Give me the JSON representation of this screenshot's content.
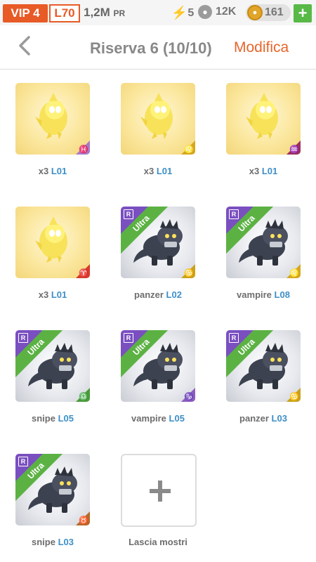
{
  "topbar": {
    "vip": "VIP 4",
    "level": "L70",
    "pr_value": "1,2M",
    "pr_unit": "PR",
    "energy": "5",
    "paw": "12K",
    "coins": "161",
    "add_label": "+"
  },
  "header": {
    "title": "Riserva 6 (10/10)",
    "edit": "Modifica"
  },
  "items": [
    {
      "name": "x3",
      "level": "L01",
      "style": "gold",
      "sign": "♓",
      "sign_color": "#a77ac4"
    },
    {
      "name": "x3",
      "level": "L01",
      "style": "gold",
      "sign": "♌",
      "sign_color": "#d4a81e"
    },
    {
      "name": "x3",
      "level": "L01",
      "style": "gold",
      "sign": "♒",
      "sign_color": "#9c2f5d"
    },
    {
      "name": "x3",
      "level": "L01",
      "style": "gold",
      "sign": "♈",
      "sign_color": "#d63a2a"
    },
    {
      "name": "panzer",
      "level": "L02",
      "style": "ultra",
      "sign": "♋",
      "sign_color": "#c8a21a",
      "badge": "Ultra",
      "rarity": "R"
    },
    {
      "name": "vampire",
      "level": "L08",
      "style": "ultra",
      "sign": "♌",
      "sign_color": "#d4a81e",
      "badge": "Ultra",
      "rarity": "R"
    },
    {
      "name": "snipe",
      "level": "L05",
      "style": "ultra",
      "sign": "♎",
      "sign_color": "#4a9b3a",
      "badge": "Ultra",
      "rarity": "R"
    },
    {
      "name": "vampire",
      "level": "L05",
      "style": "ultra",
      "sign": "♑",
      "sign_color": "#8e5cc0",
      "badge": "Ultra",
      "rarity": "R"
    },
    {
      "name": "panzer",
      "level": "L03",
      "style": "ultra",
      "sign": "♋",
      "sign_color": "#c8a21a",
      "badge": "Ultra",
      "rarity": "R"
    },
    {
      "name": "snipe",
      "level": "L03",
      "style": "ultra",
      "sign": "♉",
      "sign_color": "#b8682a",
      "badge": "Ultra",
      "rarity": "R"
    }
  ],
  "add_slot": {
    "label": "Lascia mostri"
  }
}
